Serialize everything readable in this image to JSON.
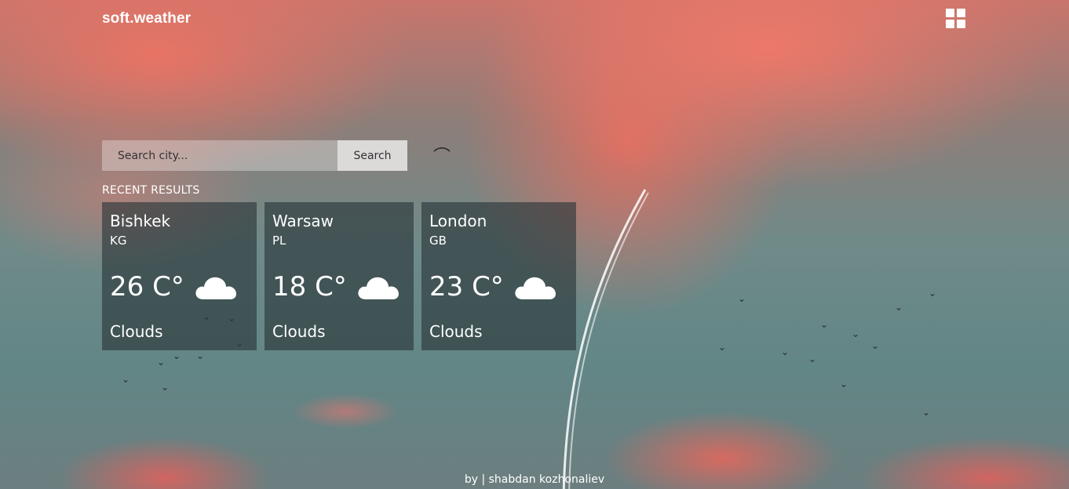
{
  "header": {
    "logo": "soft.weather",
    "menu_icon": "grid-menu-icon"
  },
  "search": {
    "placeholder": "Search city...",
    "value": "",
    "button_label": "Search"
  },
  "recent": {
    "title": "RECENT RESULTS",
    "cards": [
      {
        "city": "Bishkek",
        "country": "KG",
        "temp": "26 C°",
        "icon": "cloud-icon",
        "condition": "Clouds"
      },
      {
        "city": "Warsaw",
        "country": "PL",
        "temp": "18 C°",
        "icon": "cloud-icon",
        "condition": "Clouds"
      },
      {
        "city": "London",
        "country": "GB",
        "temp": "23 C°",
        "icon": "cloud-icon",
        "condition": "Clouds"
      }
    ]
  },
  "footer": {
    "credit": "by | shabdan kozhonaliev"
  }
}
